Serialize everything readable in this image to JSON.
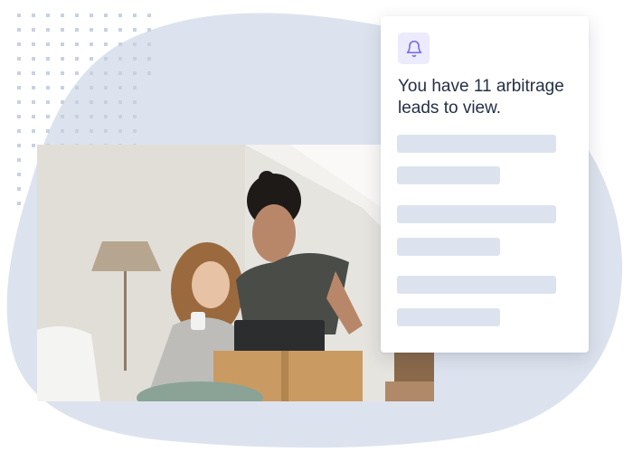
{
  "colors": {
    "blob": "#dde3ee",
    "dots": "#c9d1e0",
    "accent": "#7c6cf0",
    "accent_bg": "#ecebfd",
    "placeholder_bar": "#dde3ee",
    "text": "#243045"
  },
  "notification": {
    "icon": "bell-icon",
    "message": "You have 11 arbitrage leads to view.",
    "placeholder_line_count": 6
  },
  "photo": {
    "description_icon": "photo-couple-laptop"
  }
}
